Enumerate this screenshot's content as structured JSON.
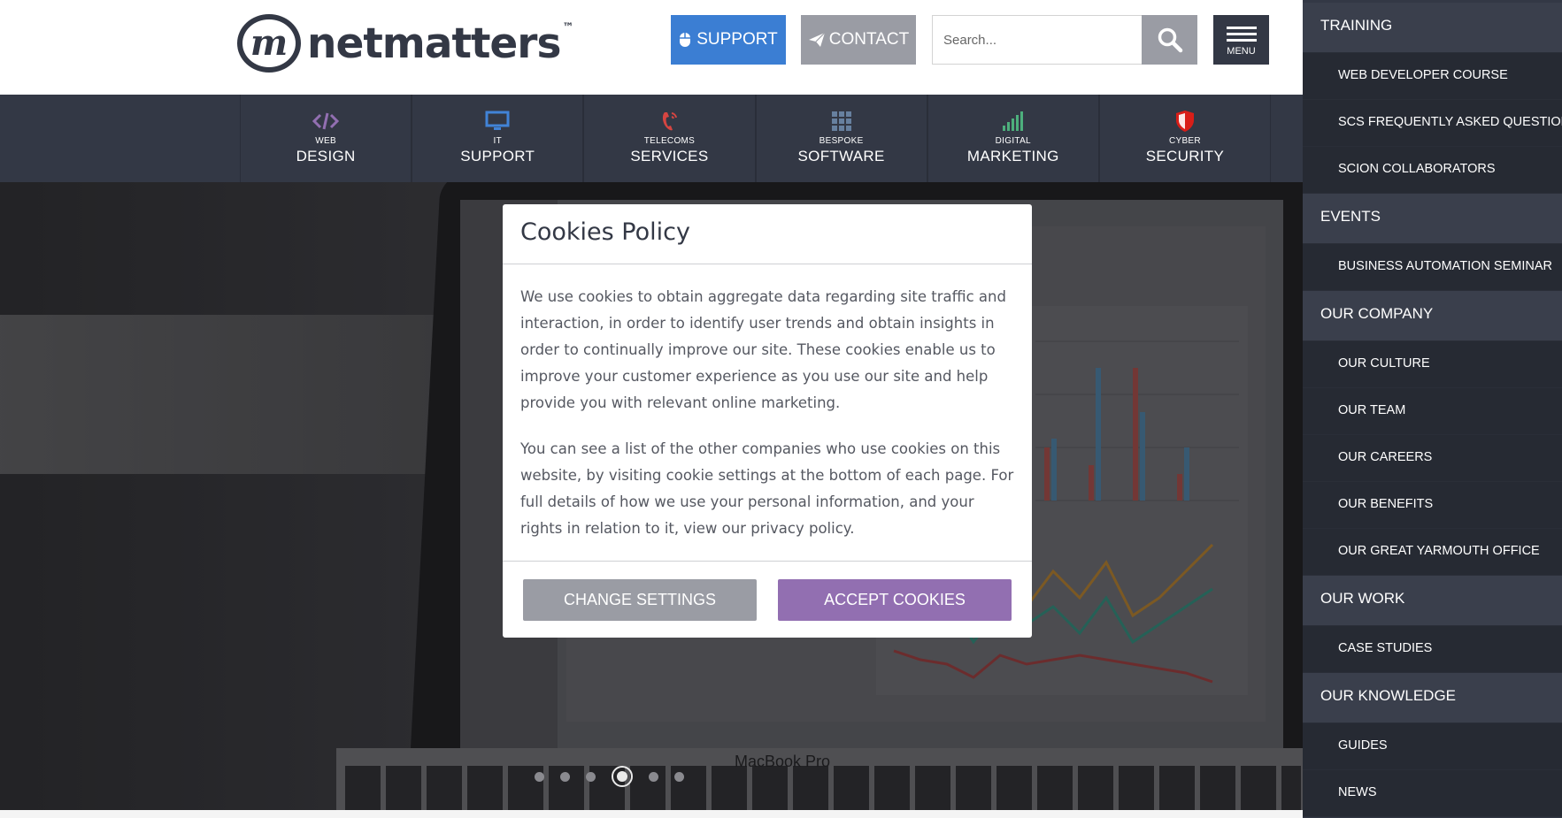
{
  "header": {
    "logo_text": "netmatters",
    "logo_mark": "m",
    "logo_tm": "™",
    "support_label": "SUPPORT",
    "contact_label": "CONTACT",
    "search_placeholder": "Search...",
    "menu_label": "MENU"
  },
  "services": [
    {
      "small": "WEB",
      "big": "DESIGN",
      "icon": "code-icon",
      "color": "#926fb1"
    },
    {
      "small": "IT",
      "big": "SUPPORT",
      "icon": "monitor-icon",
      "color": "#4183d7"
    },
    {
      "small": "TELECOMS",
      "big": "SERVICES",
      "icon": "phone-icon",
      "color": "#d64541"
    },
    {
      "small": "BESPOKE",
      "big": "SOFTWARE",
      "icon": "grid-icon",
      "color": "#67809f"
    },
    {
      "small": "DIGITAL",
      "big": "MARKETING",
      "icon": "signal-icon",
      "color": "#4daf7c"
    },
    {
      "small": "CYBER",
      "big": "SECURITY",
      "icon": "shield-icon",
      "color": "#d91e18"
    }
  ],
  "hero": {
    "device_label": "MacBook Pro",
    "slide_count": 6,
    "active_slide": 4
  },
  "cookie_modal": {
    "title": "Cookies Policy",
    "paragraph1": "We use cookies to obtain aggregate data regarding site traffic and interaction, in order to identify user trends and obtain insights in order to continually improve our site. These cookies enable us to improve your customer experience as you use our site and help provide you with relevant online marketing.",
    "paragraph2": "You can see a list of the other companies who use cookies on this website, by visiting cookie settings at the bottom of each page. For full details of how we use your personal information, and your rights in relation to it, view our privacy policy.",
    "change_settings_label": "CHANGE SETTINGS",
    "accept_label": "ACCEPT COOKIES"
  },
  "side_menu": {
    "close_label": "×",
    "items": [
      {
        "label": "TRAINING",
        "type": "cat"
      },
      {
        "label": "WEB DEVELOPER COURSE",
        "type": "sub"
      },
      {
        "label": "SCS FREQUENTLY ASKED QUESTIONS",
        "type": "sub"
      },
      {
        "label": "SCION COLLABORATORS",
        "type": "sub"
      },
      {
        "label": "EVENTS",
        "type": "cat"
      },
      {
        "label": "BUSINESS AUTOMATION SEMINAR",
        "type": "sub"
      },
      {
        "label": "OUR COMPANY",
        "type": "cat"
      },
      {
        "label": "OUR CULTURE",
        "type": "sub"
      },
      {
        "label": "OUR TEAM",
        "type": "sub"
      },
      {
        "label": "OUR CAREERS",
        "type": "sub"
      },
      {
        "label": "OUR BENEFITS",
        "type": "sub"
      },
      {
        "label": "OUR GREAT YARMOUTH OFFICE",
        "type": "sub"
      },
      {
        "label": "OUR WORK",
        "type": "cat"
      },
      {
        "label": "CASE STUDIES",
        "type": "sub"
      },
      {
        "label": "OUR KNOWLEDGE",
        "type": "cat"
      },
      {
        "label": "GUIDES",
        "type": "sub"
      },
      {
        "label": "NEWS",
        "type": "sub"
      }
    ]
  },
  "colors": {
    "brand_dark": "#333845",
    "support_blue": "#3b7ed3",
    "grey_button": "#9a9ca4",
    "accept_purple": "#926fb1"
  }
}
